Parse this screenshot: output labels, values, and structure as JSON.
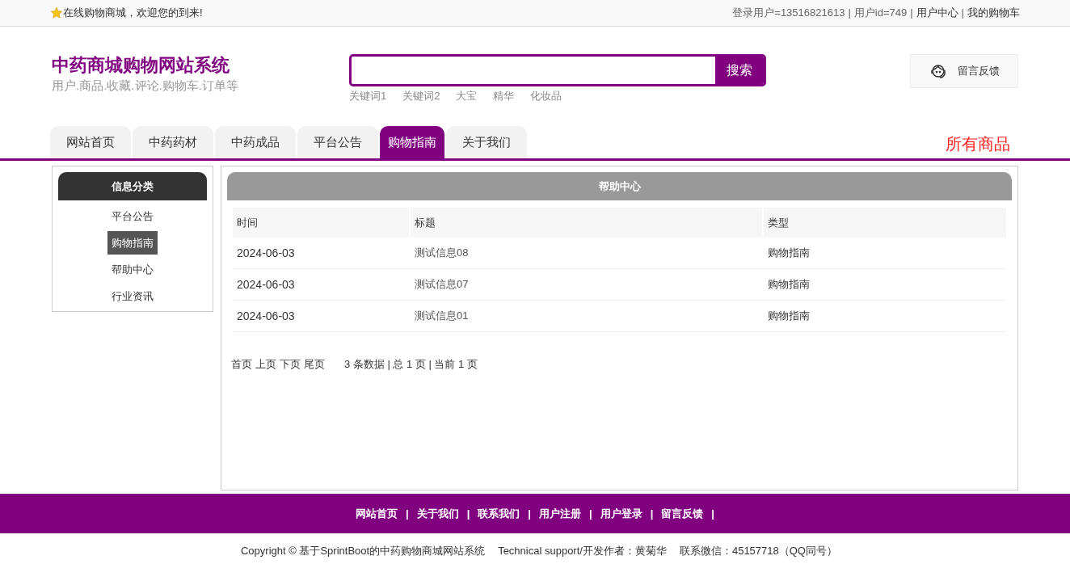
{
  "top_bar": {
    "welcome": "在线购物商城，欢迎您的到来!",
    "separator": "|",
    "links": [
      {
        "label": "登录用户=13516821613",
        "kind": "text"
      },
      {
        "label": "用户id=749",
        "kind": "text"
      },
      {
        "label": "用户中心",
        "kind": "link"
      },
      {
        "label": "我的购物车",
        "kind": "link"
      }
    ]
  },
  "header": {
    "title": "中药商城购物网站系统",
    "subtitle": "用户.商品.收藏.评论.购物车.订单等",
    "search": {
      "button": "搜索",
      "keywords": [
        "关键词1",
        "关键词2",
        "大宝",
        "精华",
        "化妆品"
      ]
    },
    "feedback": "留言反馈"
  },
  "nav": {
    "tabs": [
      {
        "label": "网站首页",
        "selected": false
      },
      {
        "label": "中药药材",
        "selected": false
      },
      {
        "label": "中药成品",
        "selected": false
      },
      {
        "label": "平台公告",
        "selected": false
      },
      {
        "label": "购物指南",
        "selected": true
      },
      {
        "label": "关于我们",
        "selected": false
      }
    ],
    "all_products": "所有商品"
  },
  "sidebar": {
    "title": "信息分类",
    "items": [
      {
        "label": "平台公告",
        "selected": false
      },
      {
        "label": "购物指南",
        "selected": true
      },
      {
        "label": "帮助中心",
        "selected": false
      },
      {
        "label": "行业资讯",
        "selected": false
      }
    ]
  },
  "content": {
    "title": "帮助中心",
    "table": {
      "columns": [
        "时间",
        "标题",
        "类型"
      ],
      "rows": [
        {
          "date": "2024-06-03",
          "title": "测试信息08",
          "type": "购物指南"
        },
        {
          "date": "2024-06-03",
          "title": "测试信息07",
          "type": "购物指南"
        },
        {
          "date": "2024-06-03",
          "title": "测试信息01",
          "type": "购物指南"
        }
      ]
    },
    "pagination": {
      "links": [
        "首页",
        "上页",
        "下页",
        "尾页"
      ],
      "summary": "3 条数据 | 总 1 页 | 当前 1 页"
    }
  },
  "footer": {
    "separator": "|",
    "links": [
      "网站首页",
      "关于我们",
      "联系我们",
      "用户注册",
      "用户登录",
      "留言反馈"
    ],
    "copyright": "Copyright © 基于SprintBoot的中药购物商城网站系统",
    "support": "Technical support/开发作者：黄菊华",
    "contact": "联系微信：45157718（QQ同号）"
  }
}
